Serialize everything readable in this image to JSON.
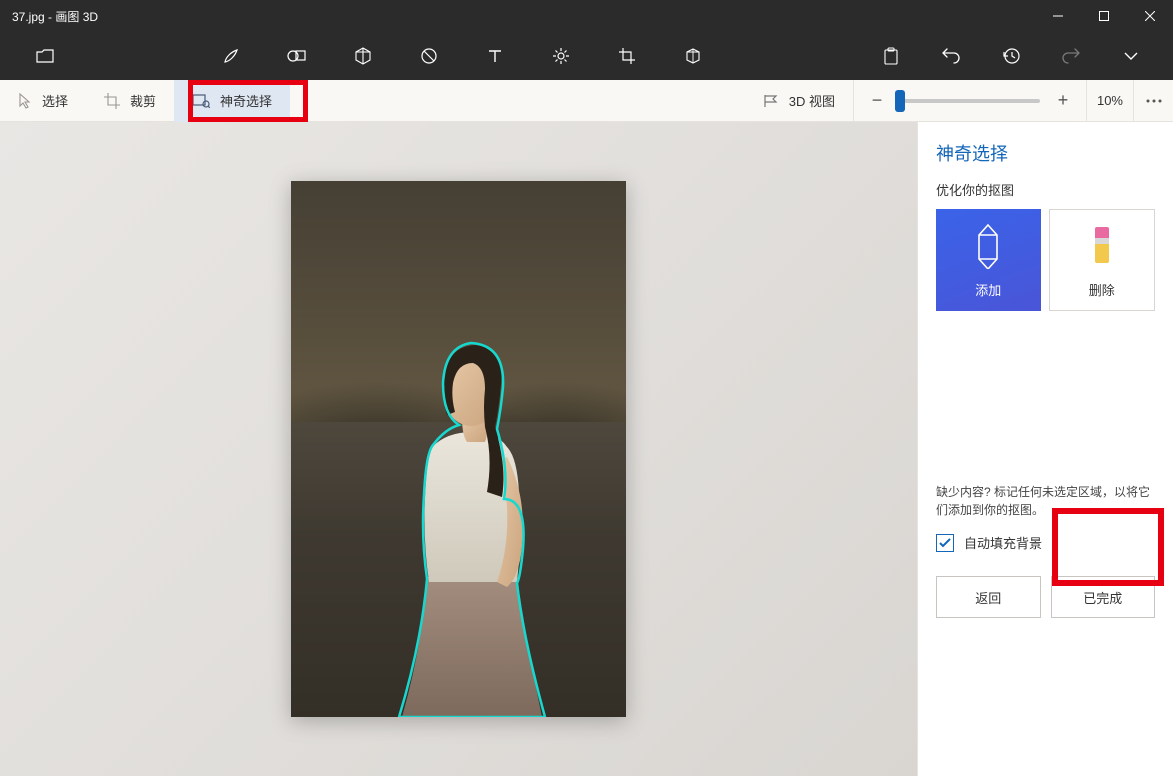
{
  "titlebar": {
    "title": "37.jpg - 画图 3D"
  },
  "toolbar_icons": {
    "file": "file-icon",
    "brush": "brush-icon",
    "shapes2d": "shapes-2d-icon",
    "shapes3d": "cube-icon",
    "stickers": "sticker-icon",
    "text": "text-icon",
    "effects": "effects-icon",
    "canvas": "crop-icon",
    "library": "library-icon",
    "paste": "paste-icon",
    "undo": "undo-icon",
    "history": "history-icon",
    "redo": "redo-icon",
    "more": "chevron-down-icon"
  },
  "secondbar": {
    "select": "选择",
    "crop": "裁剪",
    "magic": "神奇选择",
    "view3d": "3D 视图",
    "zoom_pct": "10%"
  },
  "panel": {
    "title": "神奇选择",
    "subtitle": "优化你的抠图",
    "add": "添加",
    "remove": "删除",
    "hint": "缺少内容? 标记任何未选定区域，以将它们添加到你的抠图。",
    "autofill": "自动填充背景",
    "back": "返回",
    "done": "已完成"
  }
}
